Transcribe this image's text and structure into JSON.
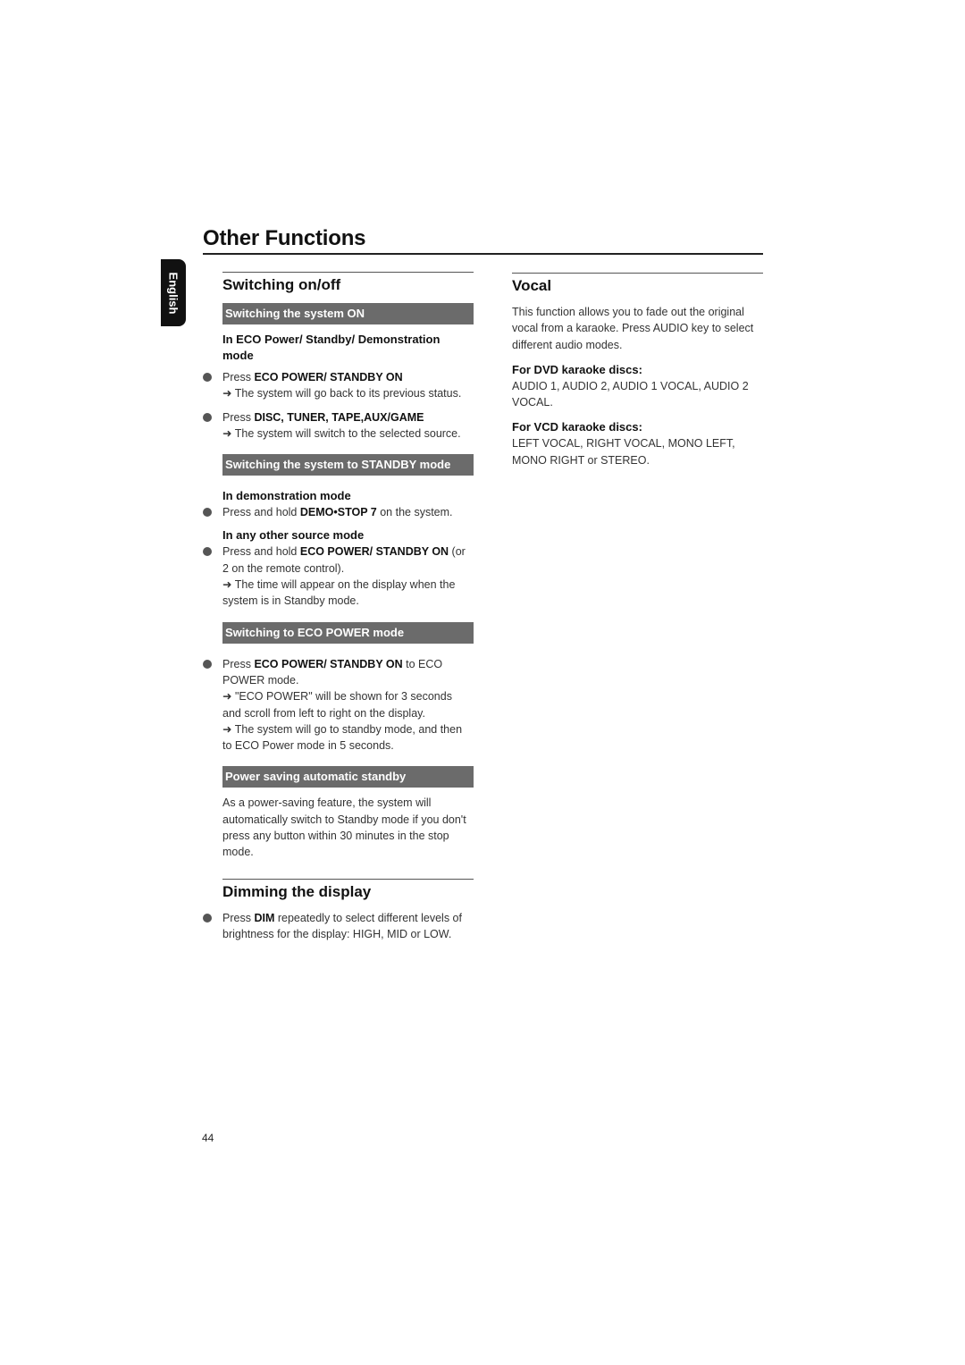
{
  "page": {
    "title": "Other Functions",
    "language_tab": "English",
    "page_number": "44"
  },
  "switching": {
    "title": "Switching on/off",
    "on_bar": "Switching the system ON",
    "on_sub": "In ECO Power/ Standby/ Demonstration mode",
    "on_item1_prefix": "Press ",
    "on_item1_bold": "ECO POWER/ STANDBY ON",
    "on_item1_result": "The system will go back to its previous status.",
    "on_item2_prefix": "Press ",
    "on_item2_bold": "DISC, TUNER, TAPE,AUX/GAME",
    "on_item2_result": "The system will switch to the selected source.",
    "standby_bar": "Switching the system to STANDBY mode",
    "standby_sub1": "In demonstration mode",
    "standby_item1_prefix": "Press and hold ",
    "standby_item1_bold": "DEMO•STOP 7",
    "standby_item1_suffix": " on the system.",
    "standby_sub2": "In any other source mode",
    "standby_item2_prefix": "Press and hold ",
    "standby_item2_bold": "ECO POWER/ STANDBY ON",
    "standby_item2_suffix": " (or 2   on the remote control).",
    "standby_item2_result": "The time will appear on the display when the system is in Standby mode.",
    "eco_bar": "Switching to ECO POWER mode",
    "eco_item_prefix": "Press ",
    "eco_item_bold": "ECO POWER/ STANDBY ON",
    "eco_item_suffix": " to ECO POWER mode.",
    "eco_result1": "\"ECO POWER\" will be shown for 3 seconds and scroll from left to right on the display.",
    "eco_result2": "The system will go to standby mode, and then to ECO Power mode in 5 seconds.",
    "auto_bar": "Power saving automatic standby",
    "auto_text": "As a power-saving feature, the system will automatically switch to Standby mode if you don't press any button within 30 minutes in the stop mode."
  },
  "dimming": {
    "title": "Dimming the display",
    "item_prefix": "Press ",
    "item_bold": "DIM",
    "item_suffix": " repeatedly to select different levels of brightness for the display: HIGH, MID or LOW."
  },
  "vocal": {
    "title": "Vocal",
    "intro": "This function allows you to fade out the original vocal from a karaoke.   Press AUDIO key to select different audio modes.",
    "dvd_sub": "For DVD karaoke discs:",
    "dvd_text": "AUDIO 1, AUDIO 2, AUDIO 1 VOCAL, AUDIO 2 VOCAL.",
    "vcd_sub": "For VCD karaoke discs:",
    "vcd_text": "LEFT VOCAL, RIGHT VOCAL, MONO LEFT, MONO RIGHT or STEREO."
  },
  "icons": {
    "arrow": "➜"
  }
}
